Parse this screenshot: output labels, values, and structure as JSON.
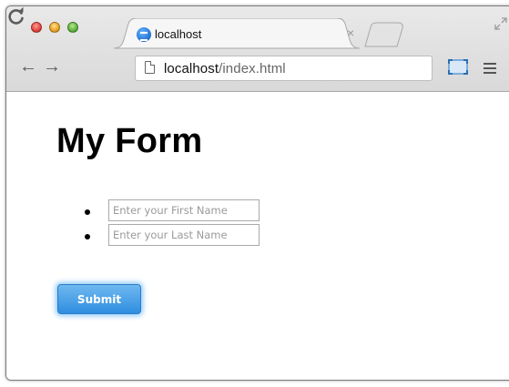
{
  "browser": {
    "tab": {
      "title": "localhost",
      "favicon": "globe-favicon-icon",
      "close_glyph": "×"
    },
    "nav": {
      "back_glyph": "←",
      "forward_glyph": "→",
      "reload_icon": "reload-icon"
    },
    "address": {
      "host": "localhost",
      "path": "/index.html"
    },
    "toolbar_icons": [
      "cast-icon",
      "menu-icon"
    ]
  },
  "page": {
    "heading": "My Form",
    "fields": [
      {
        "placeholder": "Enter your First Name",
        "value": ""
      },
      {
        "placeholder": "Enter your Last Name",
        "value": ""
      }
    ],
    "submit_label": "Submit"
  },
  "colors": {
    "submit_accent": "#2f8ee0",
    "chrome_bg": "#e0e0e0"
  }
}
